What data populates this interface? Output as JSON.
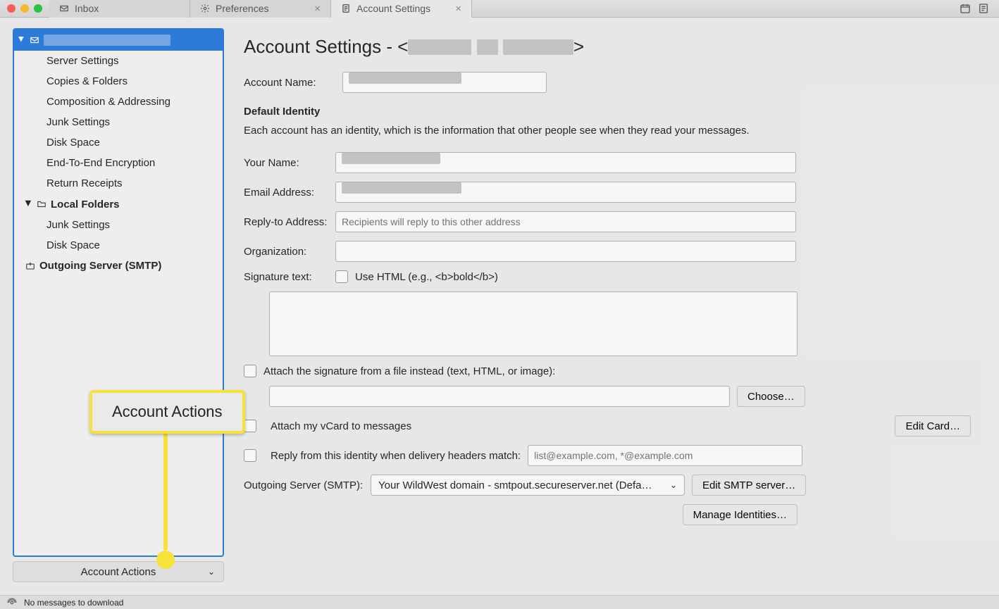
{
  "tabs": [
    {
      "label": "Inbox",
      "icon": "inbox-icon"
    },
    {
      "label": "Preferences",
      "icon": "gear-icon"
    },
    {
      "label": "Account Settings",
      "icon": "document-icon",
      "active": true
    }
  ],
  "sidebar": {
    "account_items": [
      "Server Settings",
      "Copies & Folders",
      "Composition & Addressing",
      "Junk Settings",
      "Disk Space",
      "End-To-End Encryption",
      "Return Receipts"
    ],
    "local_folders_label": "Local Folders",
    "local_items": [
      "Junk Settings",
      "Disk Space"
    ],
    "smtp_label": "Outgoing Server (SMTP)",
    "account_actions_label": "Account Actions"
  },
  "content": {
    "title_prefix": "Account Settings - <",
    "title_suffix": ">",
    "account_name_label": "Account Name:",
    "default_identity_head": "Default Identity",
    "default_identity_desc": "Each account has an identity, which is the information that other people see when they read your messages.",
    "your_name_label": "Your Name:",
    "email_label": "Email Address:",
    "replyto_label": "Reply-to Address:",
    "replyto_placeholder": "Recipients will reply to this other address",
    "org_label": "Organization:",
    "sig_label": "Signature text:",
    "use_html_label": "Use HTML (e.g., <b>bold</b>)",
    "attach_file_label": "Attach the signature from a file instead (text, HTML, or image):",
    "choose_btn": "Choose…",
    "attach_vcard_label": "Attach my vCard to messages",
    "edit_card_btn": "Edit Card…",
    "reply_match_label": "Reply from this identity when delivery headers match:",
    "reply_match_placeholder": "list@example.com, *@example.com",
    "smtp_row_label": "Outgoing Server (SMTP):",
    "smtp_select_value": "Your WildWest domain - smtpout.secureserver.net (Defa…",
    "edit_smtp_btn": "Edit SMTP server…",
    "manage_identities_btn": "Manage Identities…"
  },
  "callout": {
    "label": "Account Actions"
  },
  "statusbar": {
    "msg": "No messages to download"
  }
}
